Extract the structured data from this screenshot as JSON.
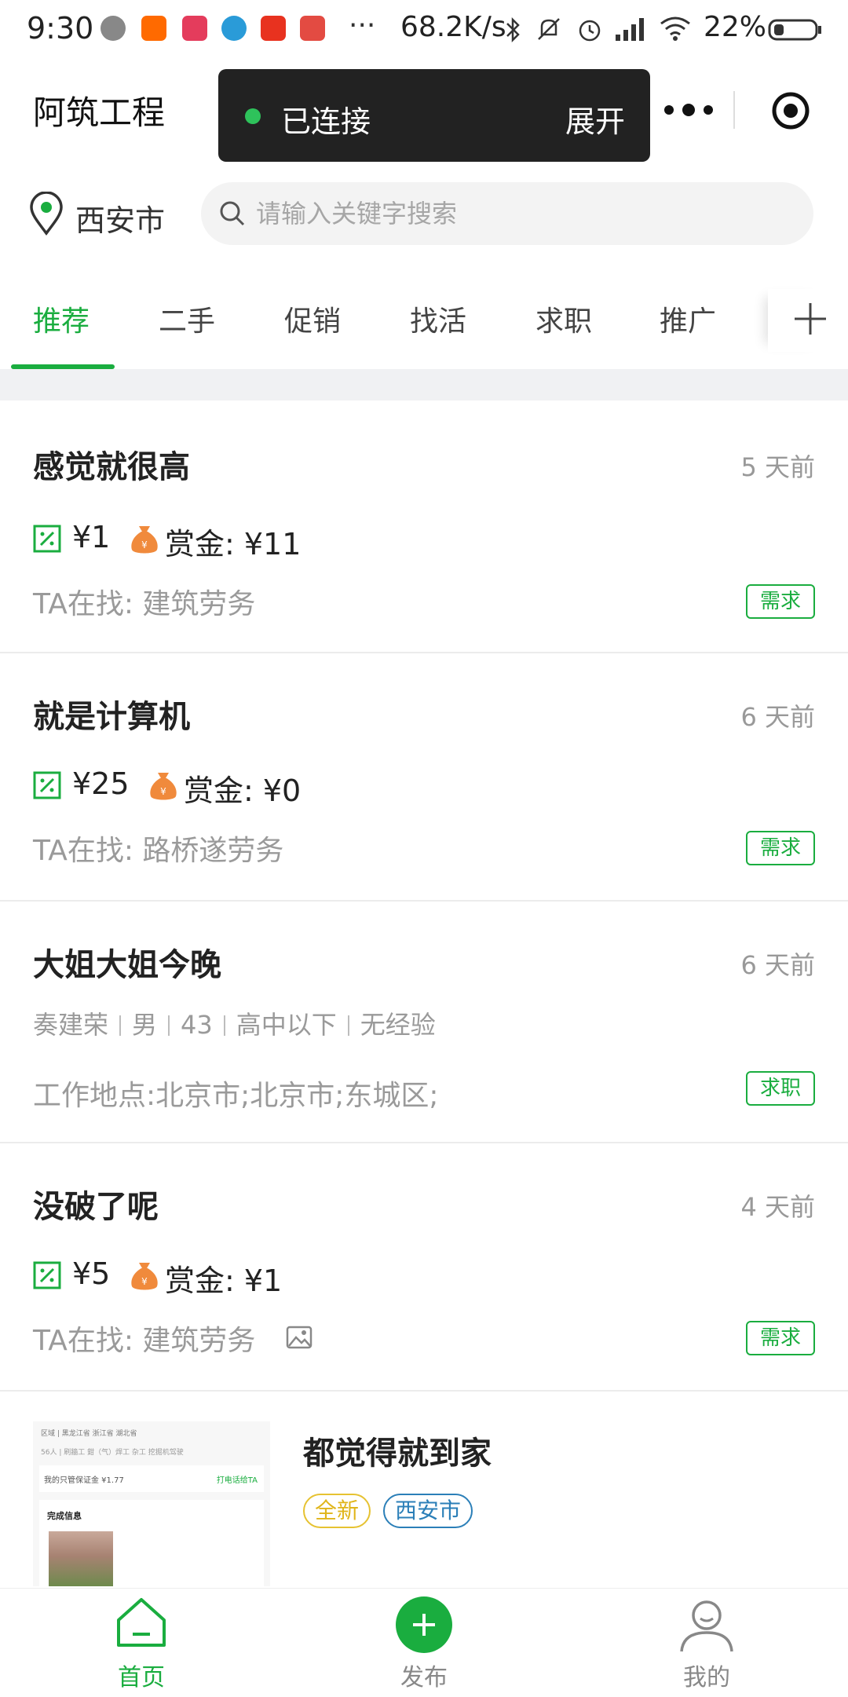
{
  "status_bar": {
    "time": "9:30",
    "network_speed": "68.2K/s",
    "battery_percent": "22%",
    "more": "···"
  },
  "header": {
    "app_title": "阿筑工程",
    "toast_status": "已连接",
    "toast_expand": "展开"
  },
  "location": {
    "city": "西安市"
  },
  "search": {
    "placeholder": "请输入关键字搜索"
  },
  "tabs": [
    {
      "label": "推荐",
      "active": true
    },
    {
      "label": "二手"
    },
    {
      "label": "促销"
    },
    {
      "label": "找活"
    },
    {
      "label": "求职"
    },
    {
      "label": "推广"
    }
  ],
  "posts": [
    {
      "title": "感觉就很高",
      "time": "5 天前",
      "price": "¥1",
      "bounty": "赏金: ¥11",
      "seeking": "TA在找: 建筑劳务",
      "tag": "需求"
    },
    {
      "title": "就是计算机",
      "time": "6 天前",
      "price": "¥25",
      "bounty": "赏金: ¥0",
      "seeking": "TA在找: 路桥遂劳务",
      "tag": "需求"
    },
    {
      "title": "大姐大姐今晚",
      "time": "6 天前",
      "meta": [
        "奏建荣",
        "男",
        "43",
        "高中以下",
        "无经验"
      ],
      "location": "工作地点:北京市;北京市;东城区;",
      "tag": "求职"
    },
    {
      "title": "没破了呢",
      "time": "4 天前",
      "price": "¥5",
      "bounty": "赏金: ¥1",
      "seeking": "TA在找: 建筑劳务",
      "tag": "需求"
    }
  ],
  "last_post": {
    "title": "都觉得就到家",
    "tags": [
      "全新",
      "西安市"
    ],
    "thumb": {
      "line1": "区域 | 黑龙江省   浙江省   湖北省",
      "line2": "56人 | 刷牆工  鉗（气）焊工  杂工  挖掘机驾驶",
      "row_left": "我的只管保证金   ¥1.77",
      "row_right": "打电话给TA",
      "box_title": "完成信息"
    }
  },
  "bottom_nav": [
    {
      "label": "首页",
      "active": true
    },
    {
      "label": "发布"
    },
    {
      "label": "我的"
    }
  ],
  "colors": {
    "accent": "#1aad3f",
    "toast_bg": "#222222",
    "tag_new": "#e0b51a",
    "tag_city": "#2b7fb8",
    "bounty_bag": "#f08a3c"
  },
  "icons": [
    "location-pin-icon",
    "search-icon",
    "plus-icon",
    "price-tag-icon",
    "money-bag-icon",
    "image-icon",
    "home-icon",
    "add-icon",
    "profile-icon",
    "more-dots-icon",
    "target-close-icon"
  ]
}
